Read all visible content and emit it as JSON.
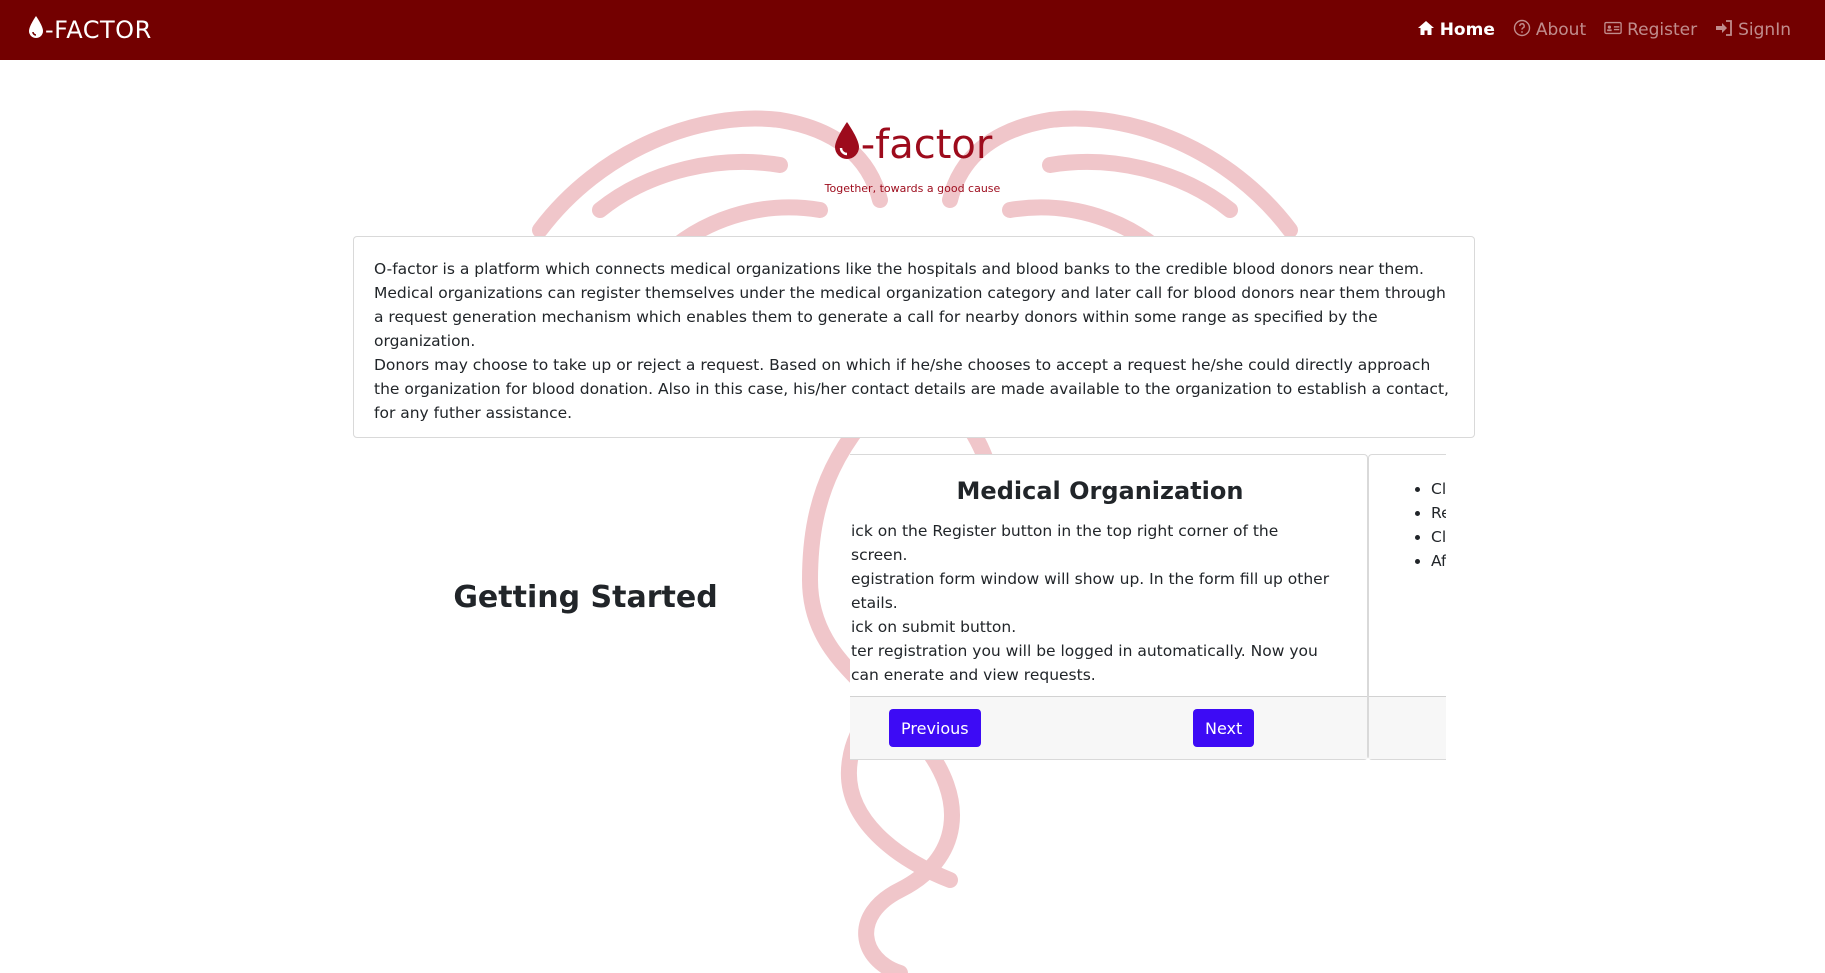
{
  "navbar": {
    "brand_text": "-FACTOR",
    "brand_icon": "blood-drop-icon",
    "links": [
      {
        "label": "Home",
        "icon": "home-icon",
        "active": true
      },
      {
        "label": "About",
        "icon": "question-circle-icon",
        "active": false
      },
      {
        "label": "Register",
        "icon": "id-card-icon",
        "active": false
      },
      {
        "label": "SignIn",
        "icon": "sign-in-icon",
        "active": false
      }
    ]
  },
  "hero": {
    "logo_text": "-factor",
    "tagline": "Together, towards a good cause"
  },
  "intro": {
    "paragraph1": "O-factor is a platform which connects medical organizations like the hospitals and blood banks to the credible blood donors near them. Medical organizations can register themselves under the medical organization category and later call for blood donors near them through a request generation mechanism which enables them to generate a call for nearby donors within some range as specified by the organization.",
    "paragraph2": "Donors may choose to take up or reject a request. Based on which if he/she chooses to accept a request he/she could directly approach the organization for blood donation. Also in this case, his/her contact details are made available to the organization to establish a contact, for any futher assistance."
  },
  "getting_started": {
    "heading": "Getting Started"
  },
  "carousel": {
    "slides": [
      {
        "title": "Medical Organization",
        "steps": [
          "ick on the Register button in the top right corner of the screen.",
          "egistration form window will show up. In the form fill up other etails.",
          "ick on submit button.",
          "ter registration you will be logged in automatically. Now you can enerate and view requests."
        ],
        "previous_label": "Previous",
        "next_label": "Next"
      },
      {
        "title": "",
        "steps": [
          "Cli",
          "Re a c",
          "Cli",
          "Af ac"
        ]
      }
    ]
  },
  "colors": {
    "navbar": "#730000",
    "brand_red": "#9d0b1c",
    "button": "#3d0bf5",
    "watermark": "#e8b4b8"
  }
}
